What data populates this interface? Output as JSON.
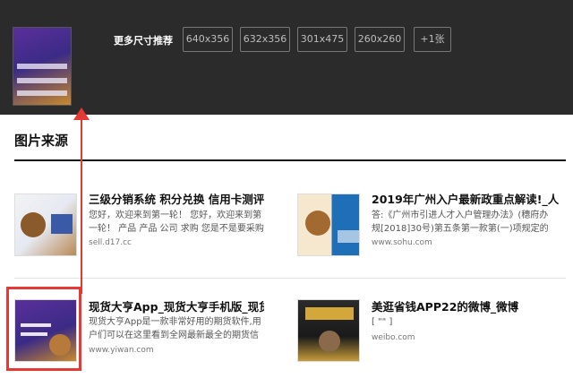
{
  "header": {
    "more_sizes_label": "更多尺寸推荐",
    "sizes": [
      "640x356",
      "632x356",
      "301x475",
      "260x260",
      "+1张"
    ]
  },
  "section": {
    "title": "图片来源"
  },
  "results": [
    {
      "title": "三级分销系统 积分兑换 信用卡测评",
      "desc": "您好，欢迎来到第一轮！ 您好，欢迎来到第一轮！ 产品 产品 公司 求购 您是不是要采购",
      "domain": "sell.d17.cc"
    },
    {
      "title": "2019年广州入户最新政重点解读!_人",
      "desc": "答:《广州市引进人才入户管理办法》(穗府办规[2018]30号)第五条第一款第(一)项规定的条",
      "domain": "www.sohu.com"
    },
    {
      "title": "现货大亨App_现货大亨手机版_现货",
      "desc": "现货大亨App是一款非常好用的期货软件,用户们可以在这里看到全网最新最全的期货信",
      "domain": "www.yiwan.com"
    },
    {
      "title": "美逛省钱APP22的微博_微博",
      "desc": "[ \"\" ]",
      "domain": "weibo.com"
    }
  ],
  "colors": {
    "topbar": "#2b2b2b",
    "highlight": "#e53935"
  }
}
